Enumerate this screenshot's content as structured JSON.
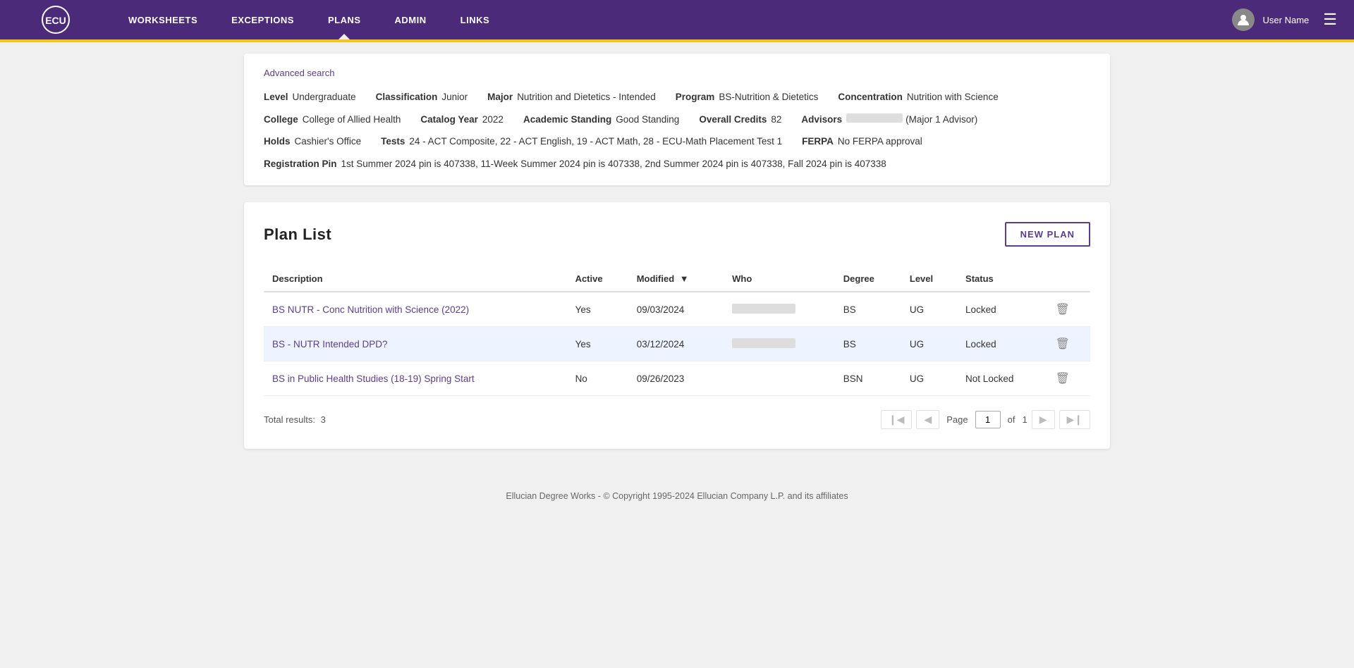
{
  "header": {
    "logo_text": "ECU",
    "nav_items": [
      {
        "label": "WORKSHEETS",
        "active": false
      },
      {
        "label": "EXCEPTIONS",
        "active": false
      },
      {
        "label": "PLANS",
        "active": true
      },
      {
        "label": "ADMIN",
        "active": false
      },
      {
        "label": "LINKS",
        "active": false
      }
    ],
    "user_name": "User Name",
    "hamburger_icon": "☰"
  },
  "student_info": {
    "advanced_search": "Advanced search",
    "row1": {
      "level_label": "Level",
      "level_value": "Undergraduate",
      "classification_label": "Classification",
      "classification_value": "Junior",
      "major_label": "Major",
      "major_value": "Nutrition and Dietetics - Intended",
      "program_label": "Program",
      "program_value": "BS-Nutrition & Dietetics",
      "concentration_label": "Concentration",
      "concentration_value": "Nutrition with Science"
    },
    "row2": {
      "college_label": "College",
      "college_value": "College of Allied Health",
      "catalog_year_label": "Catalog Year",
      "catalog_year_value": "2022",
      "academic_standing_label": "Academic Standing",
      "academic_standing_value": "Good Standing",
      "overall_credits_label": "Overall Credits",
      "overall_credits_value": "82",
      "advisors_label": "Advisors",
      "advisors_value": "(Major 1 Advisor)"
    },
    "row3": {
      "holds_label": "Holds",
      "holds_value": "Cashier's Office",
      "tests_label": "Tests",
      "tests_value": "24 - ACT Composite, 22 - ACT English, 19 - ACT Math, 28 - ECU-Math Placement Test 1",
      "ferpa_label": "FERPA",
      "ferpa_value": "No FERPA approval"
    },
    "row4": {
      "registration_pin_label": "Registration Pin",
      "registration_pin_value": "1st Summer 2024 pin is 407338, 11-Week Summer 2024 pin is 407338, 2nd Summer 2024 pin is 407338, Fall 2024 pin is 407338"
    }
  },
  "plan_list": {
    "title": "Plan List",
    "new_plan_button": "NEW PLAN",
    "columns": [
      {
        "label": "Description",
        "key": "description"
      },
      {
        "label": "Active",
        "key": "active"
      },
      {
        "label": "Modified",
        "key": "modified",
        "sortable": true
      },
      {
        "label": "Who",
        "key": "who"
      },
      {
        "label": "Degree",
        "key": "degree"
      },
      {
        "label": "Level",
        "key": "level"
      },
      {
        "label": "Status",
        "key": "status"
      }
    ],
    "rows": [
      {
        "description": "BS NUTR - Conc Nutrition with Science (2022)",
        "active": "Yes",
        "modified": "09/03/2024",
        "who": "",
        "degree": "BS",
        "level": "UG",
        "status": "Locked",
        "selected": false,
        "link": true
      },
      {
        "description": "BS - NUTR Intended DPD?",
        "active": "Yes",
        "modified": "03/12/2024",
        "who": "",
        "degree": "BS",
        "level": "UG",
        "status": "Locked",
        "selected": true,
        "link": true
      },
      {
        "description": "BS in Public Health Studies (18-19) Spring Start",
        "active": "No",
        "modified": "09/26/2023",
        "who": "",
        "degree": "BSN",
        "level": "UG",
        "status": "Not Locked",
        "selected": false,
        "link": true
      }
    ],
    "total_results_label": "Total results:",
    "total_results_value": "3",
    "pagination": {
      "page_label": "Page",
      "current_page": "1",
      "of_label": "of",
      "total_pages": "1"
    }
  },
  "footer": {
    "text": "Ellucian Degree Works - © Copyright 1995-2024 Ellucian Company L.P. and its affiliates"
  }
}
